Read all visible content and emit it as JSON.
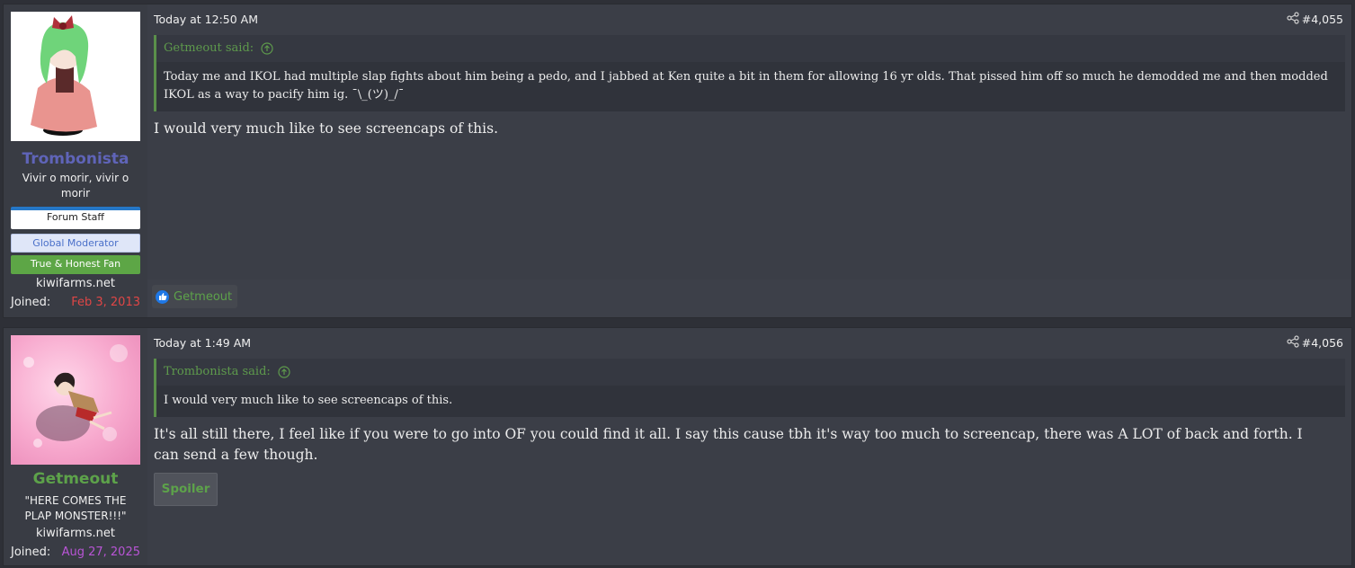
{
  "posts": [
    {
      "author": {
        "username": "Trombonista",
        "username_color": "#5f64b8",
        "title": "Vivir o morir, vivir o morir",
        "banners": [
          "Forum Staff",
          "Global Moderator",
          "True & Honest Fan"
        ],
        "site": "kiwifarms.net",
        "joined_label": "Joined:",
        "joined_date": "Feb 3, 2013",
        "joined_color": "#e04646"
      },
      "time": "Today at 12:50 AM",
      "number": "#4,055",
      "quote": {
        "author_line": "Getmeout said:",
        "text": "Today me and IKOL had multiple slap fights about him being a pedo, and I jabbed at Ken quite a bit in them for allowing 16 yr olds. That pissed him off so much he demodded me and then modded IKOL as a way to pacify him ig. ¯\\_(ツ)_/¯"
      },
      "body": "I would very much like to see screencaps of this.",
      "reaction": {
        "icon": "like-icon",
        "user": "Getmeout"
      }
    },
    {
      "author": {
        "username": "Getmeout",
        "username_color": "#5da24a",
        "title": "\"HERE COMES THE PLAP MONSTER!!!\"",
        "site": "kiwifarms.net",
        "joined_label": "Joined:",
        "joined_date": "Aug 27, 2025",
        "joined_color": "#b955d6"
      },
      "time": "Today at 1:49 AM",
      "number": "#4,056",
      "quote": {
        "author_line": "Trombonista said:",
        "text": "I would very much like to see screencaps of this."
      },
      "body": "It's all still there, I feel like if you were to go into OF you could find it all. I say this cause tbh it's way too much to screencap, there was A LOT of back and forth. I can send a few though.",
      "spoiler_label": "Spoiler"
    }
  ]
}
